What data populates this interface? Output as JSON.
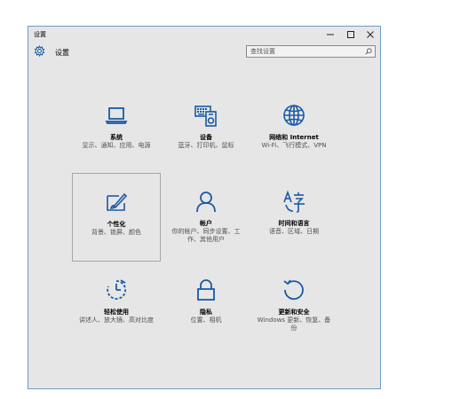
{
  "window": {
    "title": "设置",
    "accent": "#1a5aa6"
  },
  "header": {
    "title": "设置",
    "icon": "gear-icon"
  },
  "search": {
    "placeholder": "查找设置",
    "icon": "search-icon"
  },
  "tiles": [
    {
      "id": "system",
      "label": "系统",
      "desc": "显示、通知、应用、电源",
      "icon": "laptop-icon"
    },
    {
      "id": "devices",
      "label": "设备",
      "desc": "蓝牙、打印机、鼠标",
      "icon": "devices-icon"
    },
    {
      "id": "network",
      "label": "网络和 Internet",
      "desc": "Wi-Fi、飞行模式、VPN",
      "icon": "globe-icon"
    },
    {
      "id": "personalization",
      "label": "个性化",
      "desc": "背景、锁屏、颜色",
      "icon": "paintbrush-icon",
      "selected": true
    },
    {
      "id": "accounts",
      "label": "帐户",
      "desc": "你的帐户、同步设置、工作、其他用户",
      "icon": "person-icon"
    },
    {
      "id": "time-language",
      "label": "时间和语言",
      "desc": "语音、区域、日期",
      "icon": "language-icon"
    },
    {
      "id": "ease-of-access",
      "label": "轻松使用",
      "desc": "讲述人、放大镜、高对比度",
      "icon": "timer-icon"
    },
    {
      "id": "privacy",
      "label": "隐私",
      "desc": "位置、相机",
      "icon": "lock-icon"
    },
    {
      "id": "update-security",
      "label": "更新和安全",
      "desc": "Windows 更新、恢复、备份",
      "icon": "refresh-icon"
    }
  ]
}
